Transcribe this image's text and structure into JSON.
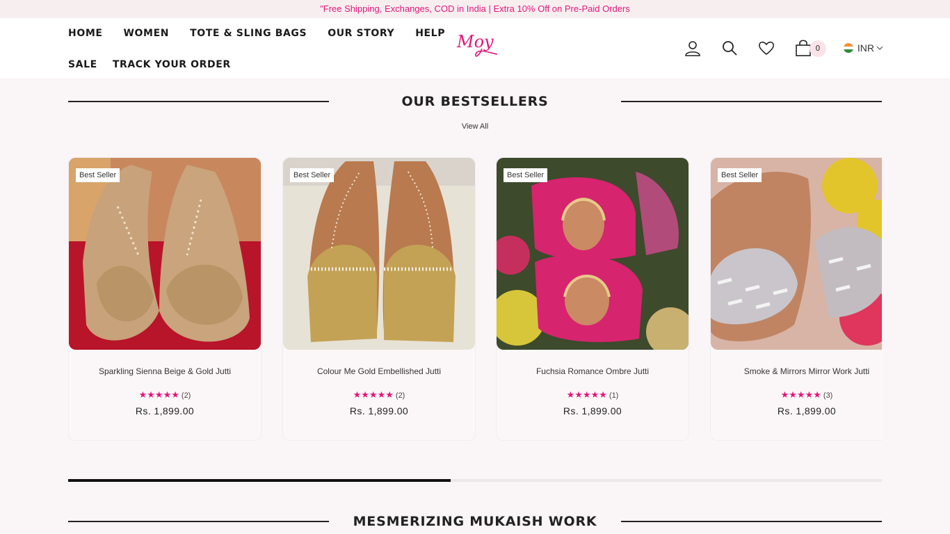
{
  "announcement": "\"Free Shipping, Exchanges, COD in India | Extra 10% Off on Pre-Paid Orders",
  "nav": {
    "row1": [
      "HOME",
      "WOMEN",
      "TOTE & SLING BAGS",
      "OUR STORY",
      "HELP"
    ],
    "row2": [
      "SALE",
      "TRACK YOUR ORDER"
    ]
  },
  "logo_text": "Moy",
  "header_icons": [
    "account-icon",
    "search-icon",
    "wishlist-heart-icon",
    "cart-bag-icon"
  ],
  "cart_count": "0",
  "currency": "INR",
  "bestsellers": {
    "title": "OUR BESTSELLERS",
    "view_all": "View All",
    "products": [
      {
        "badge": "Best Seller",
        "name": "Sparkling Sienna Beige & Gold Jutti",
        "stars": "★★★★★",
        "reviews": "(2)",
        "price": "Rs. 1,899.00"
      },
      {
        "badge": "Best Seller",
        "name": "Colour Me Gold Embellished Jutti",
        "stars": "★★★★★",
        "reviews": "(2)",
        "price": "Rs. 1,899.00"
      },
      {
        "badge": "Best Seller",
        "name": "Fuchsia Romance Ombre Jutti",
        "stars": "★★★★★",
        "reviews": "(1)",
        "price": "Rs. 1,899.00"
      },
      {
        "badge": "Best Seller",
        "name": "Smoke & Mirrors Mirror Work Jutti",
        "stars": "★★★★★",
        "reviews": "(3)",
        "price": "Rs. 1,899.00"
      }
    ]
  },
  "carousel_progress": 0.47,
  "next_section_title": "MESMERIZING MUKAISH WORK",
  "colors": {
    "accent": "#e0187a",
    "background": "#faf5f6",
    "text": "#222222"
  }
}
